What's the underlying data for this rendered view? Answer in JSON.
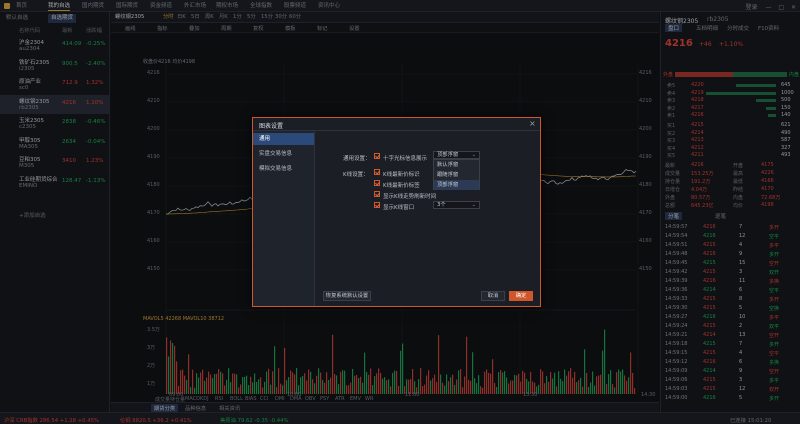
{
  "topnav": {
    "items": [
      "首页",
      "我的自选",
      "国内期货",
      "国际期货",
      "资金频道",
      "外汇市场",
      "期权市场",
      "全球指数",
      "股票频道",
      "资讯中心"
    ],
    "active_index": 1,
    "right_text": "登录"
  },
  "leftpanel": {
    "tabs": [
      "默认自选",
      "自选期货"
    ],
    "active_tab": 1,
    "headers": [
      "名称代码",
      "最新",
      "涨跌幅"
    ],
    "items": [
      {
        "name": "沪金2304",
        "code": "au2304",
        "price": "414.09",
        "pct": "-0.25%",
        "dir": "dn"
      },
      {
        "name": "铁矿石2305",
        "code": "i2305",
        "price": "900.5",
        "pct": "-2.40%",
        "dir": "dn"
      },
      {
        "name": "原油产业",
        "code": "sc0",
        "price": "712.9",
        "pct": "1.32%",
        "dir": "up"
      },
      {
        "name": "螺纹钢2305",
        "code": "rb2305",
        "price": "4216",
        "pct": "1.10%",
        "dir": "up"
      },
      {
        "name": "玉米2305",
        "code": "c2305",
        "price": "2838",
        "pct": "-0.46%",
        "dir": "dn"
      },
      {
        "name": "甲醇305",
        "code": "MA305",
        "price": "2634",
        "pct": "-0.04%",
        "dir": "dn"
      },
      {
        "name": "豆粕305",
        "code": "M305",
        "price": "3410",
        "pct": "1.23%",
        "dir": "up"
      },
      {
        "name": "工业硅期货综合",
        "code": "EMINO",
        "price": "128.47",
        "pct": "-1.13%",
        "dir": "dn"
      }
    ],
    "add_label": "+添加自选"
  },
  "center": {
    "tabs": [
      "螺纹钢2305",
      "分时",
      "日K",
      "5日",
      "周K",
      "月K",
      "1分",
      "5分",
      "15分",
      "30分",
      "60分"
    ],
    "toolbar": [
      "画线",
      "指标",
      "叠加",
      "周期",
      "复权",
      "模板",
      "标记",
      "设置"
    ],
    "info_line": "收盘价4216  均价4198",
    "price_ticks": [
      "4216",
      "4210",
      "4200",
      "4190",
      "4180",
      "4170",
      "4160",
      "4150"
    ],
    "volume_ticks": [
      "3.5万",
      "3万",
      "2万",
      "1万"
    ],
    "time_ticks": [
      "09:00",
      "10:00",
      "11:00",
      "13:30",
      "14:30"
    ],
    "indicator_line": "MAVOL5 42268  MAVOL10 38712",
    "bottom_tabs": [
      "期货分类",
      "品种信息",
      "相关资讯"
    ],
    "bottom_active": 0,
    "indicator_tabs": [
      "成交量",
      "持仓量",
      "MACD",
      "KDJ",
      "RSI",
      "BOLL",
      "BIAS",
      "CCI",
      "DMI",
      "DMA",
      "OBV",
      "PSY",
      "ATR",
      "EMV",
      "WR"
    ]
  },
  "rightpanel": {
    "title": "螺纹钢2305",
    "code": "rb2305",
    "price": "4216",
    "change": "+46",
    "pct": "+1.10%",
    "tabs": [
      "盘口",
      "五档明细",
      "分时成交",
      "F10资料"
    ],
    "bar_left": "外盘",
    "bar_right": "内盘",
    "asks": [
      {
        "label": "卖5",
        "price": "4220",
        "vol": "645"
      },
      {
        "label": "卖4",
        "price": "4219",
        "vol": "1000"
      },
      {
        "label": "卖3",
        "price": "4218",
        "vol": "500"
      },
      {
        "label": "卖2",
        "price": "4217",
        "vol": "150"
      },
      {
        "label": "卖1",
        "price": "4216",
        "vol": "140"
      }
    ],
    "bids": [
      {
        "label": "买1",
        "price": "4215",
        "vol": "621"
      },
      {
        "label": "买2",
        "price": "4214",
        "vol": "490"
      },
      {
        "label": "买3",
        "price": "4213",
        "vol": "587"
      },
      {
        "label": "买4",
        "price": "4212",
        "vol": "327"
      },
      {
        "label": "买5",
        "price": "4211",
        "vol": "493"
      }
    ],
    "stats": [
      [
        "最新",
        "4216",
        "开盘",
        "4175"
      ],
      [
        "成交量",
        "153.25万",
        "最高",
        "4226"
      ],
      [
        "持仓量",
        "191.2万",
        "最低",
        "4166"
      ],
      [
        "日增仓",
        "4.04万",
        "昨结",
        "4170"
      ],
      [
        "外盘",
        "80.57万",
        "内盘",
        "72.68万"
      ],
      [
        "总额",
        "645.23亿",
        "均价",
        "4198"
      ]
    ],
    "trade_tabs": [
      "分笔",
      "逐笔"
    ],
    "trades": [
      [
        "14:59:57",
        "4216",
        "7",
        "多开"
      ],
      [
        "14:59:54",
        "4216",
        "12",
        "空平"
      ],
      [
        "14:59:51",
        "4215",
        "4",
        "多平"
      ],
      [
        "14:59:48",
        "4216",
        "9",
        "多开"
      ],
      [
        "14:59:45",
        "4215",
        "15",
        "空开"
      ],
      [
        "14:59:42",
        "4215",
        "3",
        "双开"
      ],
      [
        "14:59:39",
        "4216",
        "11",
        "多换"
      ],
      [
        "14:59:36",
        "4214",
        "6",
        "空平"
      ],
      [
        "14:59:33",
        "4215",
        "8",
        "多开"
      ],
      [
        "14:59:30",
        "4215",
        "5",
        "空换"
      ],
      [
        "14:59:27",
        "4216",
        "10",
        "多平"
      ],
      [
        "14:59:24",
        "4215",
        "2",
        "双平"
      ],
      [
        "14:59:21",
        "4214",
        "13",
        "空开"
      ],
      [
        "14:59:18",
        "4215",
        "7",
        "多开"
      ],
      [
        "14:59:15",
        "4215",
        "4",
        "空平"
      ],
      [
        "14:59:12",
        "4216",
        "6",
        "多换"
      ],
      [
        "14:59:09",
        "4214",
        "9",
        "空开"
      ],
      [
        "14:59:06",
        "4215",
        "3",
        "多平"
      ],
      [
        "14:59:03",
        "4215",
        "12",
        "双开"
      ],
      [
        "14:59:00",
        "4216",
        "5",
        "多开"
      ]
    ]
  },
  "statusbar": {
    "items": [
      {
        "text": "沪深 CRB指数 286.54 +1.28 +0.45%",
        "dir": "up"
      },
      {
        "text": "伦铜 8820.5 +36.2 +0.41%",
        "dir": "up"
      },
      {
        "text": "美原油 79.62 -0.35 -0.44%",
        "dir": "dn"
      }
    ],
    "right": "已连接  15:01:20"
  },
  "dialog": {
    "title": "图表设置",
    "close": "×",
    "nav": [
      "通用",
      "实盘交易信息",
      "模拟交易信息"
    ],
    "nav_active": 0,
    "general_label": "通用设置：",
    "kline_label": "K线设置：",
    "crosshair_label": "十字光标信息展示",
    "crosshair_value": "顶部浮窗",
    "options": [
      "默认浮窗",
      "跟随浮窗",
      "顶部浮窗"
    ],
    "options_highlight": 2,
    "kline_checks": [
      "K线最新价标识",
      "K线最新价标签",
      "显示K线走势刷新时间",
      "显示K线窗口"
    ],
    "window_count": "3个",
    "reset_label": "恢复系统默认设置",
    "cancel_label": "取消",
    "ok_label": "确定"
  }
}
